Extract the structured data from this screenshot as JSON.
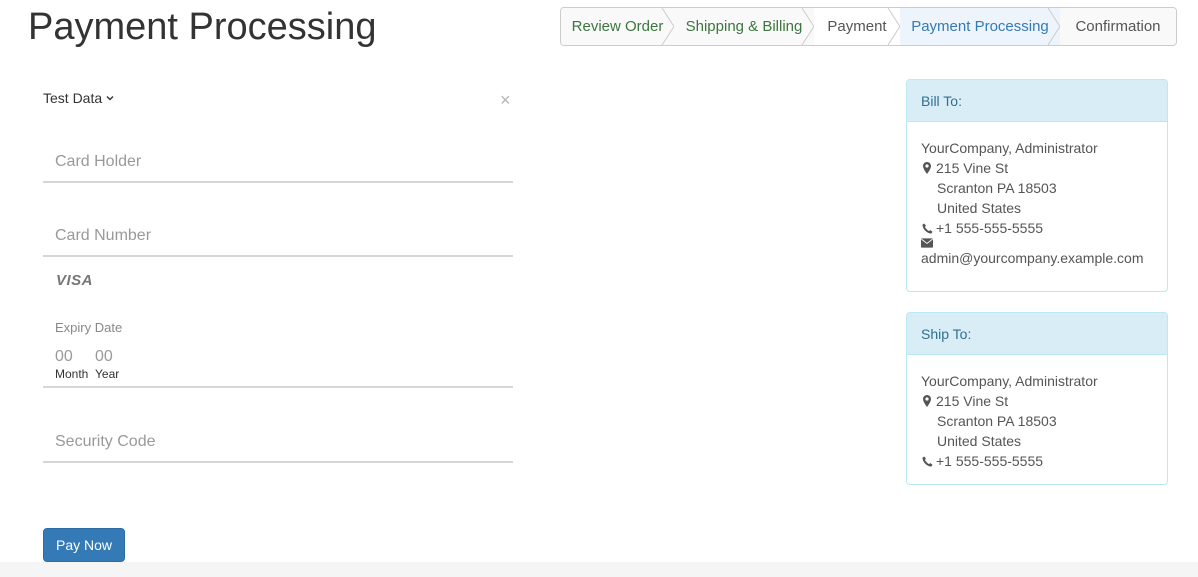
{
  "page": {
    "title": "Payment Processing"
  },
  "wizard": {
    "steps": [
      {
        "label": "Review Order",
        "state": "done"
      },
      {
        "label": "Shipping & Billing",
        "state": "done"
      },
      {
        "label": "Payment",
        "state": "plain"
      },
      {
        "label": "Payment Processing",
        "state": "active"
      },
      {
        "label": "Confirmation",
        "state": "todo"
      }
    ]
  },
  "form": {
    "test_data_label": "Test Data",
    "close_glyph": "×",
    "card_holder_placeholder": "Card Holder",
    "card_number_placeholder": "Card Number",
    "card_brand": "VISA",
    "expiry_label": "Expiry Date",
    "month_placeholder": "00",
    "year_placeholder": "00",
    "month_label": "Month",
    "year_label": "Year",
    "security_code_placeholder": "Security Code",
    "pay_button": "Pay Now"
  },
  "bill_to": {
    "heading": "Bill To:",
    "name": "YourCompany, Administrator",
    "street": "215 Vine St",
    "city": "Scranton PA 18503",
    "country": "United States",
    "phone": "+1 555-555-5555",
    "email": "admin@yourcompany.example.com"
  },
  "ship_to": {
    "heading": "Ship To:",
    "name": "YourCompany, Administrator",
    "street": "215 Vine St",
    "city": "Scranton PA 18503",
    "country": "United States",
    "phone": "+1 555-555-5555"
  },
  "colors": {
    "primary": "#337ab7",
    "done_step": "#3c763d",
    "panel_heading_bg": "#d9edf7",
    "panel_heading_text": "#31708f"
  }
}
